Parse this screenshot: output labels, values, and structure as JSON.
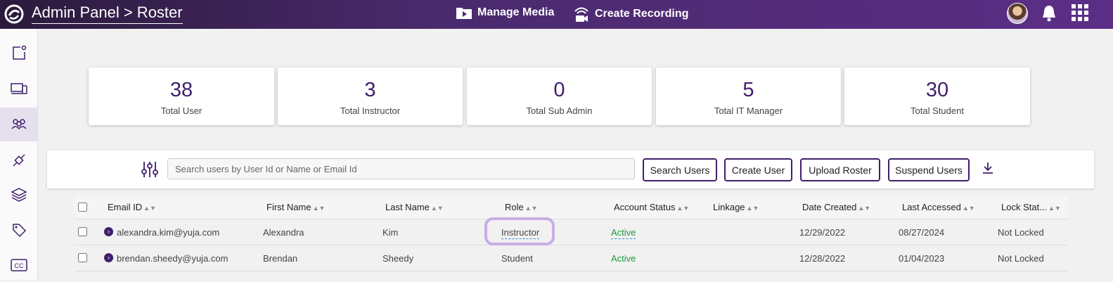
{
  "header": {
    "title": "Admin Panel > Roster",
    "manage_media": "Manage Media",
    "create_recording": "Create Recording"
  },
  "colors": {
    "brand": "#4a2a6d",
    "accent": "#3f1f6b",
    "active_status": "#1e9a3e",
    "highlight": "#c8aee4"
  },
  "icons": {
    "logo": "yuja-logo",
    "media": "play-folder-icon",
    "recording": "broadcast-camera-icon",
    "notifications": "bell-icon",
    "apps": "grid-icon",
    "filter": "sliders-icon",
    "download": "download-icon"
  },
  "sidebar": {
    "items": [
      {
        "icon": "new-document-icon"
      },
      {
        "icon": "devices-icon"
      },
      {
        "icon": "users-icon",
        "active": true
      },
      {
        "icon": "integrations-icon"
      },
      {
        "icon": "layers-icon"
      },
      {
        "icon": "tag-icon"
      },
      {
        "icon": "closed-captions-icon"
      }
    ]
  },
  "stats": [
    {
      "value": "38",
      "label": "Total User"
    },
    {
      "value": "3",
      "label": "Total Instructor"
    },
    {
      "value": "0",
      "label": "Total Sub Admin"
    },
    {
      "value": "5",
      "label": "Total IT Manager"
    },
    {
      "value": "30",
      "label": "Total Student"
    }
  ],
  "toolbar": {
    "search_placeholder": "Search users by User Id or Name or Email Id",
    "search_button": "Search Users",
    "create_button": "Create User",
    "upload_button": "Upload Roster",
    "suspend_button": "Suspend Users"
  },
  "table": {
    "columns": [
      "Email ID",
      "First Name",
      "Last Name",
      "Role",
      "Account Status",
      "Linkage",
      "Date Created",
      "Last Accessed",
      "Lock Stat..."
    ],
    "rows": [
      [
        "alexandra.kim@yuja.com",
        "Alexandra",
        "Kim",
        "Instructor",
        "Active",
        "",
        "12/29/2022",
        "08/27/2024",
        "Not Locked"
      ],
      [
        "brendan.sheedy@yuja.com",
        "Brendan",
        "Sheedy",
        "Student",
        "Active",
        "",
        "12/28/2022",
        "01/04/2023",
        "Not Locked"
      ]
    ]
  }
}
